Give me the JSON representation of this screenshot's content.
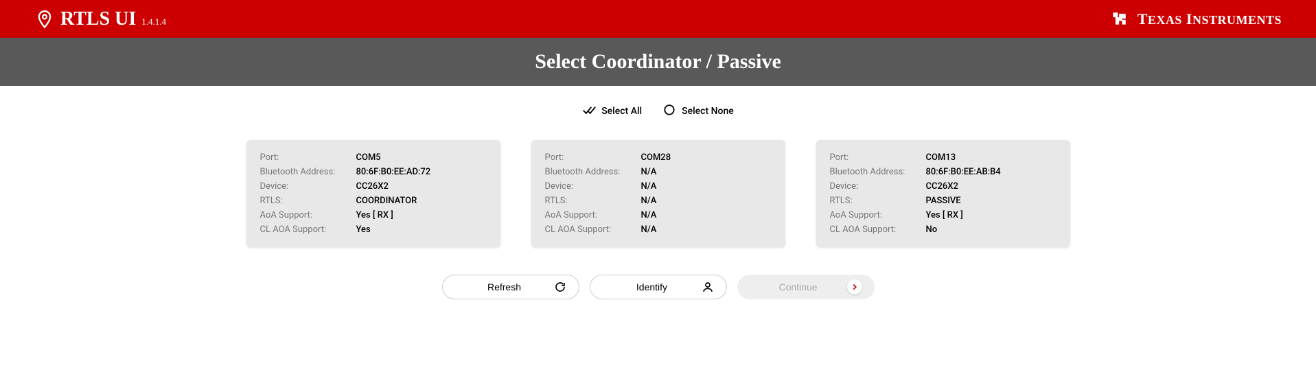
{
  "header": {
    "app_title": "RTLS UI",
    "version": "1.4.1.4",
    "brand": "Texas Instruments"
  },
  "subheader": {
    "title": "Select Coordinator / Passive"
  },
  "selection": {
    "select_all": "Select All",
    "select_none": "Select None"
  },
  "field_labels": {
    "port": "Port:",
    "bluetooth_address": "Bluetooth Address:",
    "device": "Device:",
    "rtls": "RTLS:",
    "aoa_support": "AoA Support:",
    "cl_aoa_support": "CL AOA Support:"
  },
  "devices": [
    {
      "port": "COM5",
      "bluetooth_address": "80:6F:B0:EE:AD:72",
      "device": "CC26X2",
      "rtls": "COORDINATOR",
      "aoa_support": "Yes [ RX ]",
      "cl_aoa_support": "Yes"
    },
    {
      "port": "COM28",
      "bluetooth_address": "N/A",
      "device": "N/A",
      "rtls": "N/A",
      "aoa_support": "N/A",
      "cl_aoa_support": "N/A"
    },
    {
      "port": "COM13",
      "bluetooth_address": "80:6F:B0:EE:AB:B4",
      "device": "CC26X2",
      "rtls": "PASSIVE",
      "aoa_support": "Yes [ RX ]",
      "cl_aoa_support": "No"
    }
  ],
  "buttons": {
    "refresh": "Refresh",
    "identify": "Identify",
    "continue": "Continue"
  }
}
